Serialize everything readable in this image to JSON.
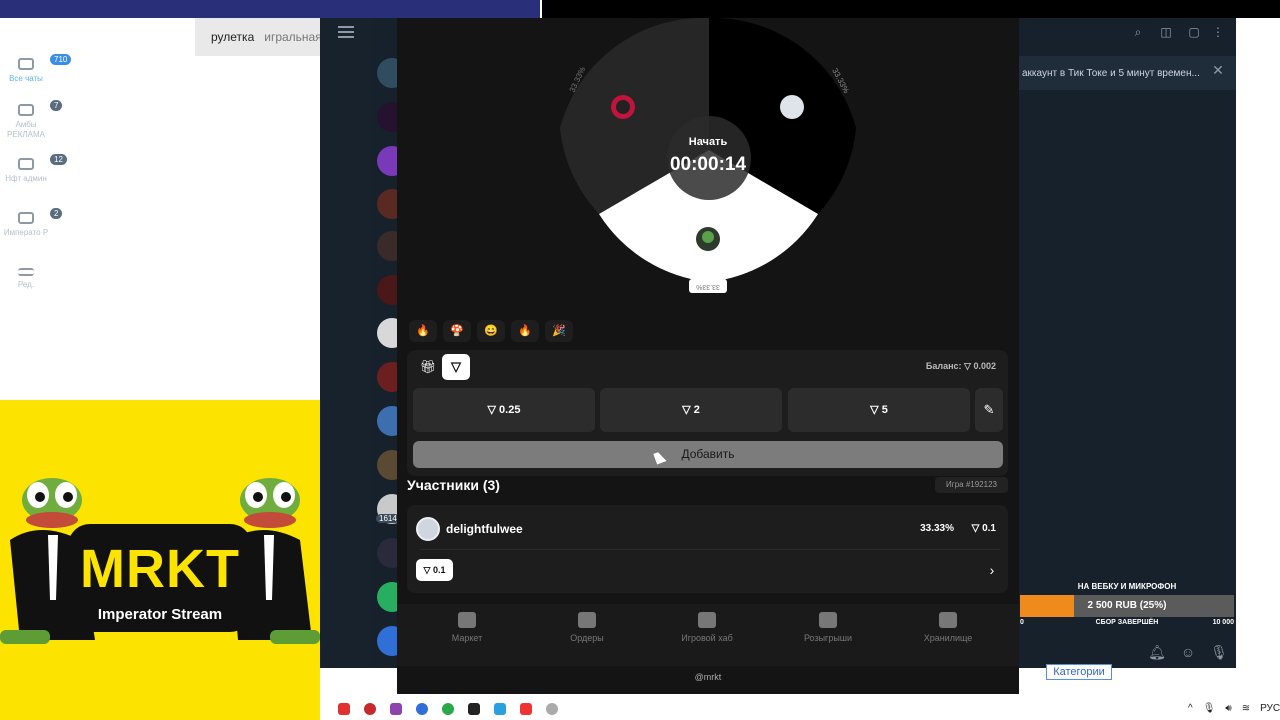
{
  "browser_tabs": [
    "рулетка",
    "игральная"
  ],
  "telegram": {
    "folders": [
      {
        "label": "Все чаты",
        "badge": "710"
      },
      {
        "label": "Амбы РЕКЛАМА",
        "badge": "7"
      },
      {
        "label": "Нфт админ",
        "badge": "12"
      },
      {
        "label": "Императо Р",
        "badge": "2"
      },
      {
        "label": "Ред.",
        "badge": ""
      }
    ],
    "pinned_text": "аккаунт в Тик Токе и 5 минут времен...",
    "chat_badge": "1614"
  },
  "stream_goal": {
    "title": "НА ВЕБКУ И МИКРОФОН",
    "progress_text": "2 500 RUB (25%)",
    "progress_fraction": 0.25,
    "min": "0",
    "status": "СБОР ЗАВЕРШЁН",
    "max": "10 000",
    "categories_link": "Категории"
  },
  "logo": {
    "title": "MRKT",
    "subtitle": "Imperator Stream"
  },
  "wheel": {
    "start_label": "Начать",
    "timer": "00:00:14",
    "segments": [
      {
        "pct_label": "33.33%",
        "color": "#262626"
      },
      {
        "pct_label": "33.33%",
        "color": "#000000"
      },
      {
        "pct_label": "33.33%",
        "color": "#ffffff"
      }
    ]
  },
  "reactions": [
    "🔥",
    "🍄",
    "😄",
    "🔥",
    "🎉"
  ],
  "bet_panel": {
    "balance_label": "Баланс:",
    "balance_value": "▽ 0.002",
    "amounts": [
      "▽ 0.25",
      "▽ 2",
      "▽ 5"
    ],
    "add_label": "Добавить"
  },
  "participants": {
    "title": "Участники (3)",
    "game_id": "Игра #192123",
    "items": [
      {
        "name": "delightfulwee",
        "percent": "33.33%",
        "bet": "▽ 0.1",
        "chip": "▽ 0.1"
      }
    ]
  },
  "nav": [
    {
      "label": "Маркет"
    },
    {
      "label": "Ордеры"
    },
    {
      "label": "Игровой хаб"
    },
    {
      "label": "Розыгрыши"
    },
    {
      "label": "Хранилище"
    }
  ],
  "footer": "@mrkt",
  "tray": {
    "lang": "РУС"
  }
}
